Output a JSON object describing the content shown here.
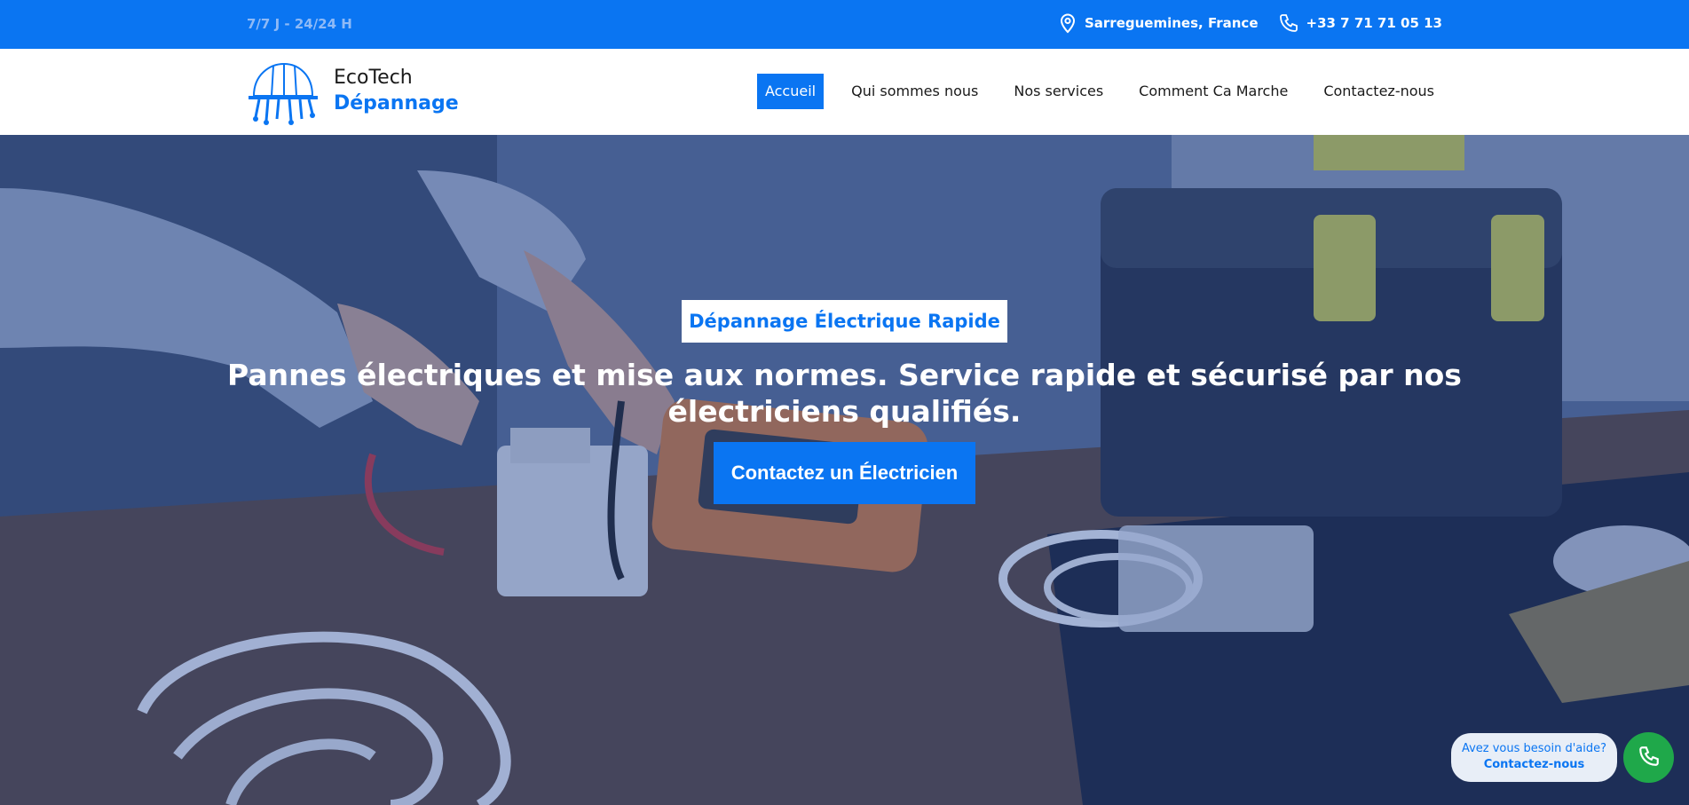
{
  "topbar": {
    "hours": "7/7 J - 24/24 H",
    "location": "Sarreguemines, France",
    "phone": "+33 7 71 71 05 13",
    "location_icon": "map-pin-icon",
    "phone_icon": "phone-icon"
  },
  "brand": {
    "line1": "EcoTech",
    "line2": "Dépannage",
    "logo_icon": "hard-hat-logo"
  },
  "nav": {
    "items": [
      {
        "label": "Accueil",
        "active": true
      },
      {
        "label": "Qui sommes nous",
        "active": false
      },
      {
        "label": "Nos services",
        "active": false
      },
      {
        "label": "Comment Ca Marche",
        "active": false
      },
      {
        "label": "Contactez-nous",
        "active": false
      }
    ]
  },
  "hero": {
    "tag": "Dépannage Électrique Rapide",
    "headline": "Pannes électriques et mise aux normes. Service rapide et sécurisé par nos électriciens qualifiés.",
    "cta": "Contactez un Électricien"
  },
  "help_widget": {
    "question": "Avez vous besoin d'aide?",
    "link": "Contactez-nous",
    "call_icon": "phone-icon"
  },
  "colors": {
    "primary": "#0a75f2",
    "call_green": "#1fa84a"
  }
}
